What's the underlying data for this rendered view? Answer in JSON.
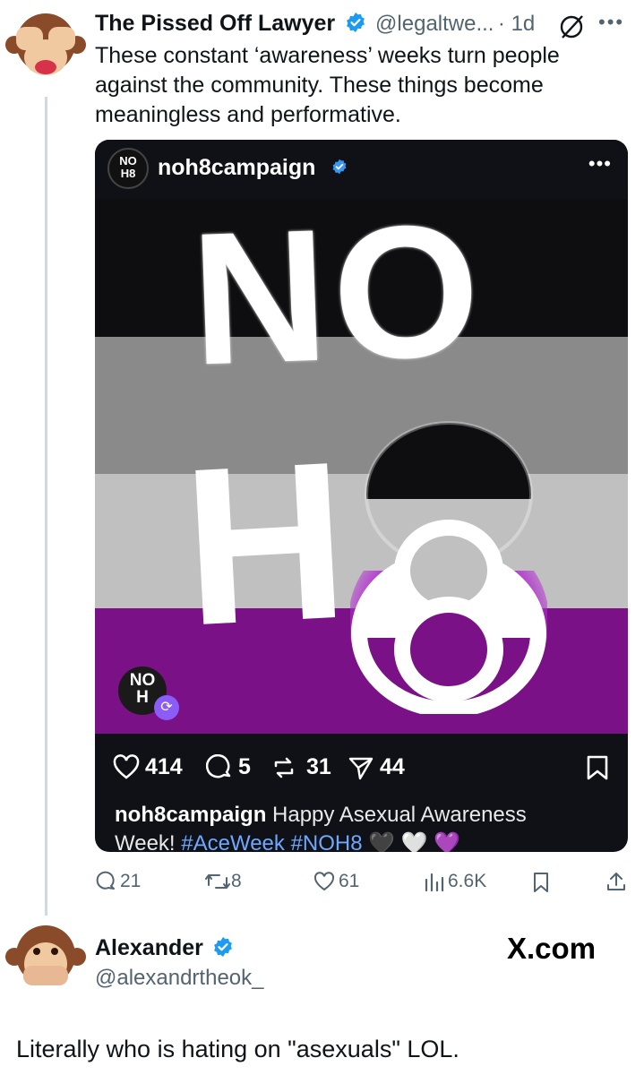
{
  "tweet": {
    "author_name": "The Pissed Off Lawyer",
    "handle": "@legaltwe...",
    "time": "· 1d",
    "text_lines": [
      "These constant ‘awareness’ weeks turn people",
      "against the community. These things become",
      "meaningless and performative."
    ],
    "actions": {
      "replies": "21",
      "reposts": "8",
      "likes": "61",
      "views": "6.6K"
    }
  },
  "embed": {
    "account": "noh8campaign",
    "avatar_text_1": "NO",
    "avatar_text_2": "H8",
    "logo_text_1": "NO",
    "logo_text_2": "H",
    "big_text_1": "NO",
    "big_text_2": "H",
    "big_text_3": "8",
    "likes": "414",
    "comments": "5",
    "reposts": "31",
    "shares": "44",
    "caption_user": "noh8campaign",
    "caption_text": "Happy Asexual Awareness",
    "caption_text_2": "Week!",
    "hashtag_1": "#AceWeek",
    "hashtag_2": "#NOH8",
    "emojis": "🖤 🤍 💜",
    "flag_colors": [
      "#0e0e10",
      "#8a8a8a",
      "#c0c0c0",
      "#7b1186"
    ]
  },
  "reply": {
    "author_name": "Alexander",
    "handle": "@alexandrtheok_",
    "text": "Literally who is hating on \"asexuals\" LOL."
  },
  "watermark": "X.com",
  "colors": {
    "verified": "#1d9bf0",
    "muted": "#536471"
  }
}
